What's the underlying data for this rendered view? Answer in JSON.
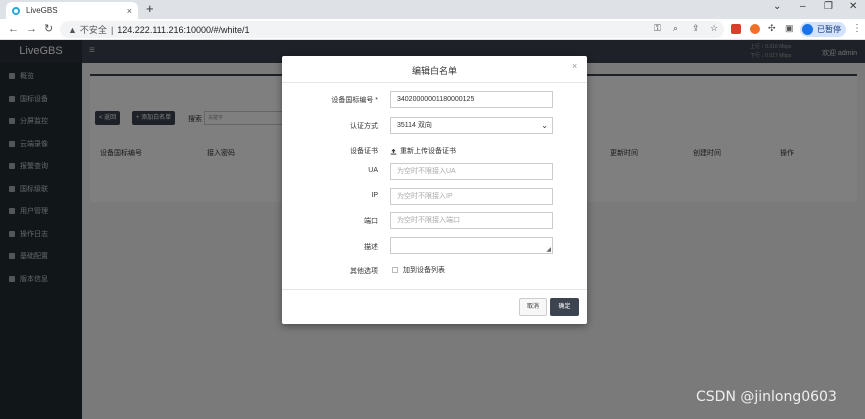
{
  "browser": {
    "tab_title": "LiveGBS",
    "tab_close": "×",
    "new_tab": "+",
    "address_security": "不安全",
    "address_url": "124.222.111.216:10000/#/white/1",
    "profile_label": "已暂停",
    "window_controls": [
      "⌄",
      "–",
      "❐",
      "✕"
    ]
  },
  "app": {
    "brand": "LiveGBS",
    "rate_up": "0.016 Mbps",
    "rate_down": "0.017 Mbps",
    "rate_up_label": "上行",
    "rate_down_label": "下行",
    "welcome": "欢迎 admin",
    "sidebar": [
      {
        "label": "概览",
        "icon": "dashboard-icon"
      },
      {
        "label": "国标设备",
        "icon": "camera-icon"
      },
      {
        "label": "分屏监控",
        "icon": "grid-icon"
      },
      {
        "label": "云端录像",
        "icon": "cloud-icon"
      },
      {
        "label": "报警查询",
        "icon": "bell-icon"
      },
      {
        "label": "国标级联",
        "icon": "share-icon"
      },
      {
        "label": "用户管理",
        "icon": "user-icon"
      },
      {
        "label": "操作日志",
        "icon": "log-icon"
      },
      {
        "label": "基础配置",
        "icon": "gear-icon"
      },
      {
        "label": "版本信息",
        "icon": "info-icon"
      }
    ],
    "toolbar": {
      "back_label": "< 返回",
      "add_label": "+ 添加白名单",
      "search_label": "搜索",
      "search_placeholder": "关键字"
    },
    "table_headers": [
      "设备国标编号",
      "接入密码",
      "更新时间",
      "创建时间",
      "操作"
    ]
  },
  "modal": {
    "title": "编辑白名单",
    "close": "×",
    "fields": {
      "device_id_label": "设备国标编号 *",
      "device_id_value": "34020000001180000125",
      "auth_label": "认证方式",
      "auth_value": "35114 双向",
      "cert_label": "设备证书",
      "cert_link": "重新上传设备证书",
      "ua_label": "UA",
      "ua_placeholder": "为空时不限接入UA",
      "ip_label": "IP",
      "ip_placeholder": "为空时不限接入IP",
      "port_label": "端口",
      "port_placeholder": "为空时不限接入端口",
      "desc_label": "描述",
      "other_label": "其他选项",
      "checkbox_label": "加到设备列表"
    },
    "cancel_label": "取消",
    "ok_label": "确定"
  },
  "watermark": "CSDN @jinlong0603"
}
